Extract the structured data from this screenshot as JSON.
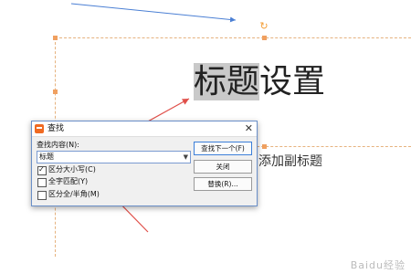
{
  "slide": {
    "title": "标题设置",
    "title_highlighted": "标题",
    "title_rest": "设置",
    "subtitle": "添加副标题"
  },
  "find_dialog": {
    "title": "查找",
    "find_label": "查找内容(N):",
    "find_value": "标题",
    "options": {
      "match_case": "区分大小写(C)",
      "whole_word": "全字匹配(Y)",
      "width": "区分全/半角(M)"
    },
    "options_checked": {
      "match_case": true,
      "whole_word": false,
      "width": false
    },
    "buttons": {
      "find_next": "查找下一个(F)",
      "close": "关闭",
      "replace": "替换(R)..."
    }
  },
  "watermark": "Baidu经验",
  "colors": {
    "annotation_arrow": "#e0504a",
    "blue_line": "#4a7fd4",
    "selection_guides": "#e6b27e",
    "app_icon": "#f06a22"
  },
  "icons": {
    "app": "wps-app-icon",
    "close": "close-icon",
    "dropdown": "chevron-down-icon",
    "rotate": "rotate-handle-icon"
  }
}
